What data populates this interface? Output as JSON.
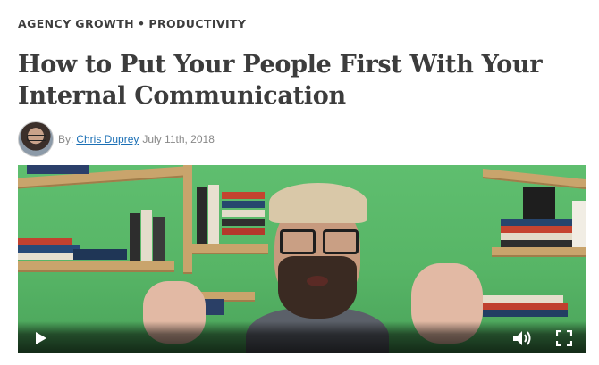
{
  "categories": [
    "AGENCY GROWTH",
    "PRODUCTIVITY"
  ],
  "category_separator": "•",
  "title": "How to Put Your People First With Your Internal Communication",
  "byline": {
    "prefix": "By:",
    "author": "Chris Duprey",
    "date": "July 11th, 2018"
  },
  "video": {
    "controls": {
      "play_icon": "play-icon",
      "volume_icon": "volume-icon",
      "fullscreen_icon": "fullscreen-icon"
    }
  },
  "colors": {
    "wall": "#5fbe6f",
    "link": "#1a6fb5",
    "heading": "#3c3c3c"
  }
}
